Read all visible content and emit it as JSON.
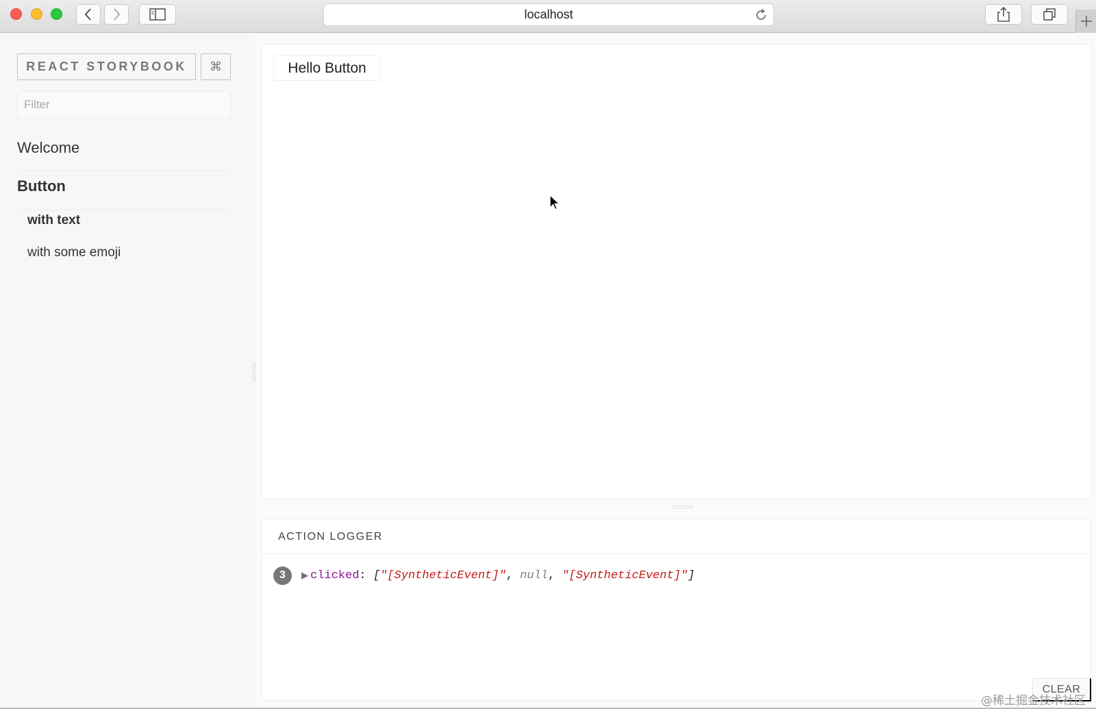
{
  "browser": {
    "url": "localhost",
    "icons": {
      "back": "chevron-left-icon",
      "forward": "chevron-right-icon",
      "sidebar": "sidebar-icon",
      "reload": "reload-icon",
      "share": "share-icon",
      "tabs": "tabs-icon",
      "new_tab": "plus-icon"
    }
  },
  "sidebar": {
    "brand": "REACT STORYBOOK",
    "shortcut": "⌘",
    "filter_placeholder": "Filter",
    "kinds": [
      {
        "label": "Welcome"
      },
      {
        "label": "Button",
        "selected": true,
        "stories": [
          {
            "label": "with text",
            "selected": true
          },
          {
            "label": "with some emoji"
          }
        ]
      }
    ]
  },
  "preview": {
    "button_label": "Hello Button"
  },
  "action_logger": {
    "title": "ACTION LOGGER",
    "entry": {
      "count": "3",
      "name": "clicked",
      "args": [
        "\"[SyntheticEvent]\"",
        "null",
        "\"[SyntheticEvent]\""
      ]
    },
    "clear_label": "CLEAR"
  },
  "watermark": "@稀土掘金技术社区",
  "colors": {
    "close": "#fc5f57",
    "minimize": "#fdbc2e",
    "zoom": "#28c840",
    "log_key": "#881391",
    "log_string": "#c41a16"
  }
}
